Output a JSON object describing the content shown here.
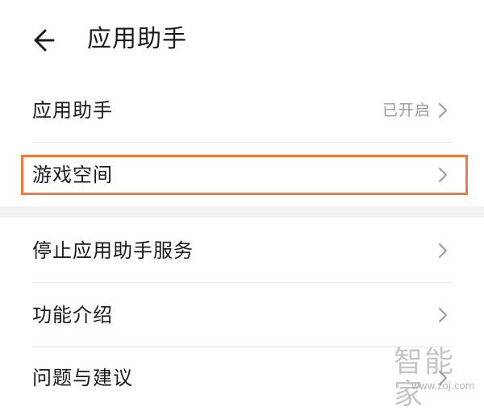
{
  "header": {
    "title": "应用助手",
    "back_icon": "arrow-left-icon"
  },
  "settings": {
    "group1": [
      {
        "label": "应用助手",
        "value": "已开启"
      },
      {
        "label": "游戏空间"
      }
    ],
    "group2": [
      {
        "label": "停止应用助手服务"
      },
      {
        "label": "功能介绍"
      },
      {
        "label": "问题与建议"
      }
    ]
  },
  "annotation": {
    "highlighted_item": "游戏空间",
    "color": "#ee7a43"
  },
  "watermark": {
    "logo_text": "智能家",
    "url": "www.zoj.com"
  }
}
